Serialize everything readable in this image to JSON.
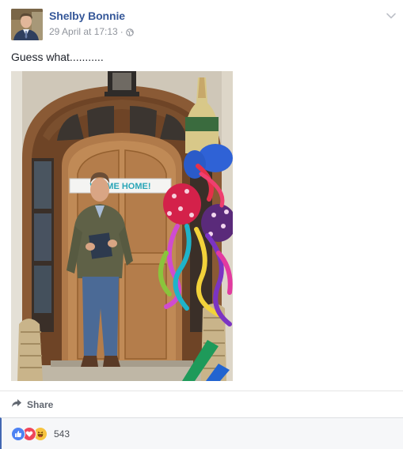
{
  "post": {
    "author_name": "Shelby Bonnie",
    "timestamp": "29 April at 17:13",
    "separator": "·",
    "privacy_icon": "globe-icon",
    "options_icon": "chevron-down-icon",
    "message": "Guess what...........",
    "photo": {
      "banner_text": "WE  ME HOME!",
      "description_icon": "photo"
    }
  },
  "actions": {
    "share_label": "Share",
    "share_icon": "share-arrow-icon"
  },
  "reactions": {
    "icons": [
      "like-reaction-icon",
      "love-reaction-icon",
      "haha-reaction-icon"
    ],
    "count": "543"
  },
  "colors": {
    "author_link": "#365899",
    "meta_text": "#90949c",
    "like_blue": "#4d82f3",
    "love_red": "#f0465a",
    "haha_yellow": "#f7c33f",
    "reaction_bar_bg": "#f6f7f9"
  }
}
